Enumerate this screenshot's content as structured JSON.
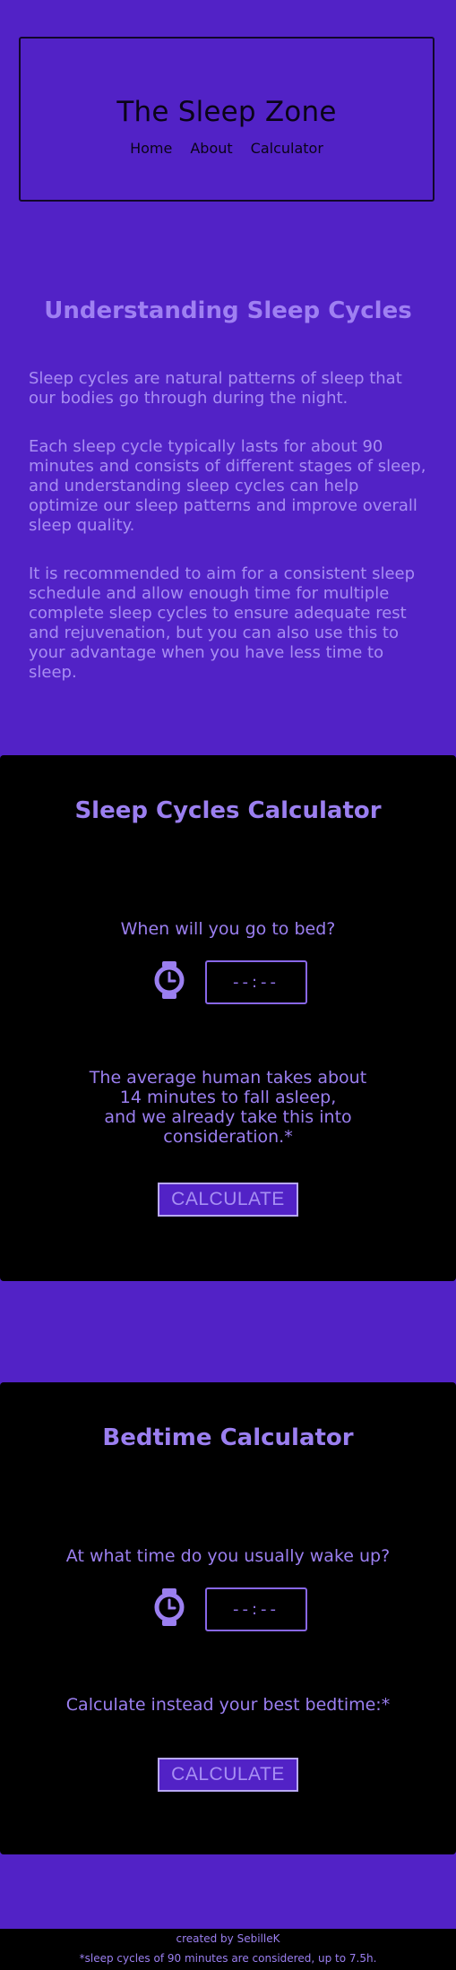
{
  "header": {
    "site_title": "The Sleep Zone",
    "nav": [
      "Home",
      "About",
      "Calculator"
    ]
  },
  "intro": {
    "title": "Understanding Sleep Cycles",
    "paragraphs": [
      "Sleep cycles are natural patterns of sleep that our bodies go through during the night.",
      "Each sleep cycle typically lasts for about 90 minutes and consists of different stages of sleep, and understanding sleep cycles can help optimize our sleep patterns and improve overall sleep quality.",
      "It is recommended to aim for a consistent sleep schedule and allow enough time for multiple complete sleep cycles to ensure adequate rest and rejuvenation, but you can also use this to your advantage when you have less time to sleep."
    ]
  },
  "sleep_calculator": {
    "title": "Sleep Cycles Calculator",
    "question": "When will you go to bed?",
    "time_placeholder": "--:--",
    "note_line1": "The average human takes about 14 minutes to fall asleep,",
    "note_line2": "and we already take this into consideration.*",
    "button": "CALCULATE"
  },
  "bedtime_calculator": {
    "title": "Bedtime Calculator",
    "question": "At what time do you usually wake up?",
    "time_placeholder": "--:--",
    "note": "Calculate instead your best bedtime:*",
    "button": "CALCULATE"
  },
  "footer": {
    "credit": "created by SebilleK",
    "note": "*sleep cycles of 90 minutes are considered, up to 7.5h."
  },
  "colors": {
    "background": "#5222c6",
    "card": "#000000",
    "accent": "#9b7ff0"
  },
  "icons": [
    "clock-icon"
  ]
}
